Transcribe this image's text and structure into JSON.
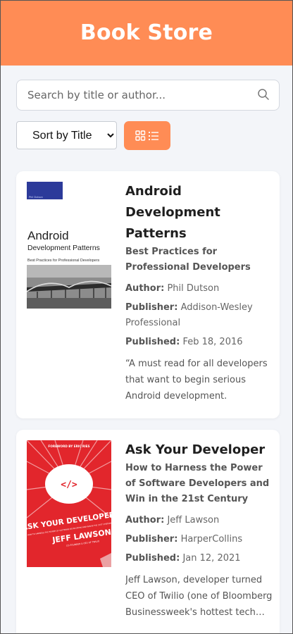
{
  "header": {
    "title": "Book Store"
  },
  "search": {
    "placeholder": "Search by title or author..."
  },
  "controls": {
    "sort_selected": "Sort by Title",
    "view_toggle_icon": "grid-list-icon"
  },
  "labels": {
    "author": "Author:",
    "publisher": "Publisher:",
    "published": "Published:"
  },
  "books": [
    {
      "title": "Android Development Patterns",
      "subtitle": "Best Practices for Professional Developers",
      "author": "Phil Dutson",
      "publisher": "Addison-Wesley Professional",
      "published": "Feb 18, 2016",
      "description": "“A must read for all developers that want to begin serious Android development.",
      "cover": {
        "small_text": "Phil Dutson",
        "title_line1": "Android",
        "title_line2": "Development Patterns",
        "tagline": "Best Practices for Professional Developers"
      }
    },
    {
      "title": "Ask Your Developer",
      "subtitle": "How to Harness the Power of Software Developers and Win in the 21st Century",
      "author": "Jeff Lawson",
      "publisher": "HarperCollins",
      "published": "Jan 12, 2021",
      "description": "Jeff Lawson, developer turned CEO of Twilio (one of Bloomberg Businessweek's hottest tech companies",
      "cover": {
        "top_text": "FOREWORD BY ERIC RIES",
        "code_glyph": "</>",
        "title": "ASK YOUR DEVELOPER",
        "tagline": "HOW TO HARNESS THE POWER OF SOFTWARE DEVELOPERS AND WIN IN THE 21ST CENTURY",
        "author": "JEFF LAWSON",
        "author_role": "CO-FOUNDER & CEO OF TWILIO"
      }
    }
  ],
  "colors": {
    "accent": "#ff8c55",
    "background": "#f3f5f9",
    "cover2_red": "#e2262c"
  }
}
